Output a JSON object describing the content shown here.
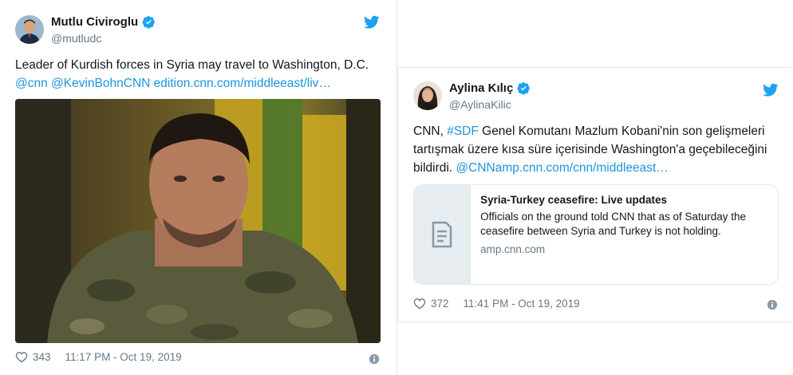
{
  "tweets": [
    {
      "name": "Mutlu Civiroglu",
      "handle": "@mutludc",
      "text_line1": "Leader of Kurdish forces in Syria may travel to Washington, D.C.",
      "links": [
        "@cnn",
        "@KevinBohnCNN",
        "edition.cnn.com/middleeast/liv…"
      ],
      "likes": "343",
      "timestamp": "11:17 PM - Oct 19, 2019"
    },
    {
      "name": "Aylina Kılıç",
      "handle": "@AylinaKilic",
      "text_part1": "CNN, ",
      "hashtag": "#SDF",
      "text_part2": " Genel Komutanı Mazlum Kobani'nin son gelişmeleri",
      "text_line2": "tartışmak üzere kısa süre içerisinde Washington'a geçebileceğini",
      "text_line3": "bildirdi. ",
      "mention": "@CNN",
      "link": "amp.cnn.com/cnn/middleeast…",
      "card": {
        "title": "Syria-Turkey ceasefire: Live updates",
        "description": "Officials on the ground told CNN that as of Saturday the ceasefire between Syria and Turkey is not holding.",
        "domain": "amp.cnn.com"
      },
      "likes": "372",
      "timestamp": "11:41 PM - Oct 19, 2019"
    }
  ],
  "icons": [
    "verified-badge-icon",
    "twitter-bird-icon",
    "heart-icon",
    "info-icon",
    "document-icon"
  ],
  "colors": {
    "link": "#1b95e0",
    "muted": "#657786",
    "border": "#e1e8ed",
    "twitter_blue": "#1da1f2"
  }
}
